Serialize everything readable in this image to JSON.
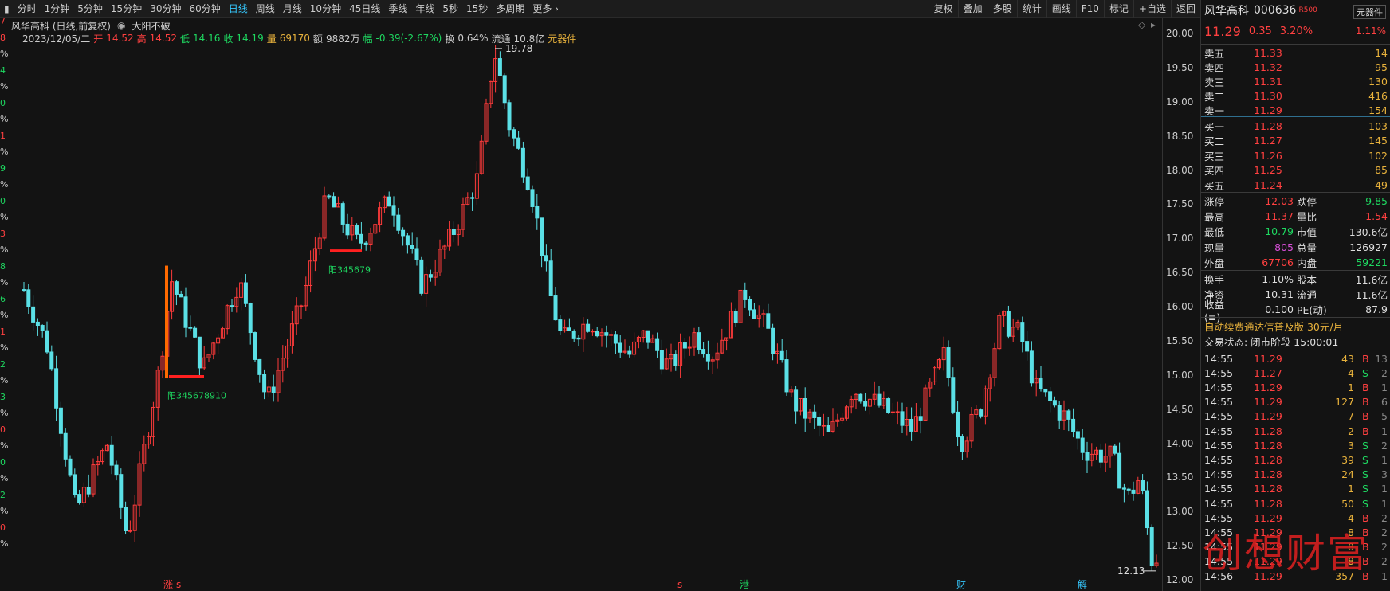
{
  "toolbar": {
    "left_icon": "panel-toggle-icon",
    "periods": [
      "分时",
      "1分钟",
      "5分钟",
      "15分钟",
      "30分钟",
      "60分钟",
      "日线",
      "周线",
      "月线",
      "10分钟",
      "45日线",
      "季线",
      "年线",
      "5秒",
      "15秒",
      "多周期",
      "更多 ›"
    ],
    "active": "日线",
    "right": [
      "复权",
      "叠加",
      "多股",
      "统计",
      "画线",
      "F10",
      "标记",
      "+自选",
      "返回"
    ]
  },
  "info": {
    "stock": "风华高科 (日线,前复权)",
    "indicator": "大阳不破",
    "date": "2023/12/05/二",
    "open_label": "开",
    "open": "14.52",
    "high_label": "高",
    "high": "14.52",
    "low_label": "低",
    "low": "14.16",
    "close_label": "收",
    "close": "14.19",
    "vol_label": "量",
    "vol": "69170",
    "amt_label": "额",
    "amt": "9882万",
    "chg_label": "幅",
    "chg": "-0.39(-2.67%)",
    "turnover_label": "换",
    "turnover": "0.64%",
    "float_label": "流通",
    "float": "10.8亿",
    "tag": "元器件"
  },
  "left_strip": [
    "7",
    "8",
    "%",
    "4",
    "%",
    "0",
    "%",
    "1",
    "%",
    "9",
    "%",
    "0",
    "%",
    "3",
    "%",
    "8",
    "%",
    "6",
    "%",
    "1",
    "%",
    "2",
    "%",
    "3",
    "%",
    "0",
    "%",
    "0",
    "%",
    "2",
    "%",
    "0",
    "%"
  ],
  "yaxis": [
    "20.00",
    "19.50",
    "19.00",
    "18.50",
    "18.00",
    "17.50",
    "17.00",
    "16.50",
    "16.00",
    "15.50",
    "15.00",
    "14.50",
    "14.00",
    "13.50",
    "13.00",
    "12.50",
    "12.00"
  ],
  "annotations": {
    "high": "19.78",
    "low": "12.13",
    "label1": "阳345678910",
    "label2": "阳345679"
  },
  "bottom_markers": [
    {
      "t": "涨",
      "c": "#ff4040"
    },
    {
      "t": "s",
      "c": "#ff4040"
    },
    {
      "t": "s",
      "c": "#ff4040"
    },
    {
      "t": "港",
      "c": "#1ed760"
    },
    {
      "t": "财",
      "c": "#35c9ff"
    },
    {
      "t": "解",
      "c": "#35c9ff"
    }
  ],
  "chart_data": {
    "type": "candlestick",
    "ylim": [
      12.0,
      20.0
    ],
    "high": 19.78,
    "low": 12.13,
    "last": {
      "date": "2023/12/05",
      "open": 14.52,
      "high": 14.52,
      "low": 14.16,
      "close": 14.19
    }
  },
  "panel": {
    "title": "风华高科",
    "code": "000636",
    "badge": "R500",
    "sector": "元器件",
    "price": "11.29",
    "change": "0.35",
    "pct": "3.20%",
    "sector_pct": "1.11%",
    "asks": [
      {
        "l": "卖五",
        "p": "11.33",
        "v": "14"
      },
      {
        "l": "卖四",
        "p": "11.32",
        "v": "95"
      },
      {
        "l": "卖三",
        "p": "11.31",
        "v": "130"
      },
      {
        "l": "卖二",
        "p": "11.30",
        "v": "416"
      },
      {
        "l": "卖一",
        "p": "11.29",
        "v": "154"
      }
    ],
    "bids": [
      {
        "l": "买一",
        "p": "11.28",
        "v": "103"
      },
      {
        "l": "买二",
        "p": "11.27",
        "v": "145"
      },
      {
        "l": "买三",
        "p": "11.26",
        "v": "102"
      },
      {
        "l": "买四",
        "p": "11.25",
        "v": "85"
      },
      {
        "l": "买五",
        "p": "11.24",
        "v": "49"
      }
    ],
    "stats": [
      {
        "l1": "涨停",
        "v1": "12.03",
        "c1": "red",
        "l2": "跌停",
        "v2": "9.85",
        "c2": "grn"
      },
      {
        "l1": "最高",
        "v1": "11.37",
        "c1": "red",
        "l2": "量比",
        "v2": "1.54",
        "c2": "red"
      },
      {
        "l1": "最低",
        "v1": "10.79",
        "c1": "grn",
        "l2": "市值",
        "v2": "130.6亿",
        "c2": "wht"
      },
      {
        "l1": "现量",
        "v1": "805",
        "c1": "mag",
        "l2": "总量",
        "v2": "126927",
        "c2": "wht"
      },
      {
        "l1": "外盘",
        "v1": "67706",
        "c1": "red",
        "l2": "内盘",
        "v2": "59221",
        "c2": "grn"
      }
    ],
    "stats2": [
      {
        "l1": "换手",
        "v1": "1.10%",
        "l2": "股本",
        "v2": "11.6亿"
      },
      {
        "l1": "净资",
        "v1": "10.31",
        "l2": "流通",
        "v2": "11.6亿"
      },
      {
        "l1": "收益(≡)",
        "v1": "0.100",
        "l2": "PE(动)",
        "v2": "87.9"
      }
    ],
    "promo": "自动续费通达信普及版  30元/月",
    "trade_state": "交易状态: 闭市阶段 15:00:01",
    "ticks": [
      {
        "t": "14:55",
        "p": "11.29",
        "v": "43",
        "s": "B",
        "n": "13"
      },
      {
        "t": "14:55",
        "p": "11.27",
        "v": "4",
        "s": "S",
        "n": "2"
      },
      {
        "t": "14:55",
        "p": "11.29",
        "v": "1",
        "s": "B",
        "n": "1"
      },
      {
        "t": "14:55",
        "p": "11.29",
        "v": "127",
        "s": "B",
        "n": "6"
      },
      {
        "t": "14:55",
        "p": "11.29",
        "v": "7",
        "s": "B",
        "n": "5"
      },
      {
        "t": "14:55",
        "p": "11.28",
        "v": "2",
        "s": "B",
        "n": "1"
      },
      {
        "t": "14:55",
        "p": "11.28",
        "v": "3",
        "s": "S",
        "n": "2"
      },
      {
        "t": "14:55",
        "p": "11.28",
        "v": "39",
        "s": "S",
        "n": "1"
      },
      {
        "t": "14:55",
        "p": "11.28",
        "v": "24",
        "s": "S",
        "n": "3"
      },
      {
        "t": "14:55",
        "p": "11.28",
        "v": "1",
        "s": "S",
        "n": "1"
      },
      {
        "t": "14:55",
        "p": "11.28",
        "v": "50",
        "s": "S",
        "n": "1"
      },
      {
        "t": "14:55",
        "p": "11.29",
        "v": "4",
        "s": "B",
        "n": "2"
      },
      {
        "t": "14:55",
        "p": "11.29",
        "v": "8",
        "s": "B",
        "n": "2"
      },
      {
        "t": "14:55",
        "p": "11.29",
        "v": "8",
        "s": "B",
        "n": "2"
      },
      {
        "t": "14:55",
        "p": "11.29",
        "v": "8",
        "s": "B",
        "n": "2"
      },
      {
        "t": "14:56",
        "p": "11.29",
        "v": "357",
        "s": "B",
        "n": "1"
      }
    ]
  },
  "watermark": "创想财富",
  "colors": {
    "up": "#ff3b3b",
    "down": "#5be0e6",
    "axis": "#333"
  }
}
